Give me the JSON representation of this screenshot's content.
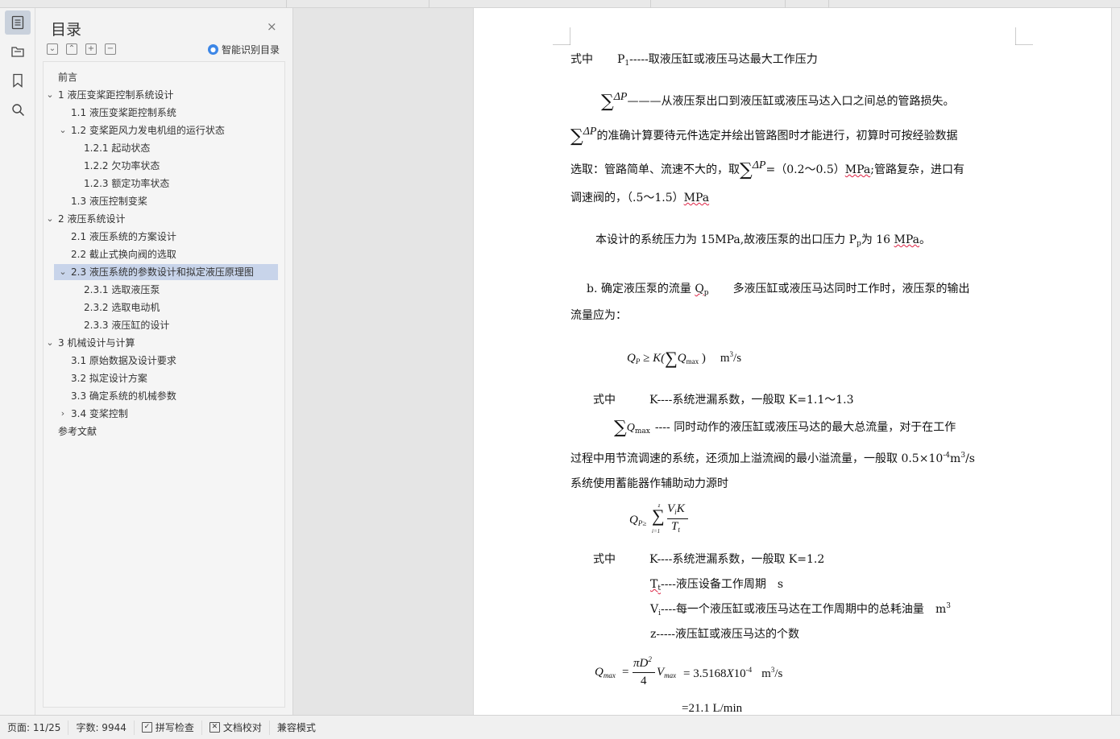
{
  "sidebar_rail": {
    "icons": [
      "outline-icon",
      "folder-tree-icon",
      "bookmark-icon",
      "search-icon"
    ]
  },
  "toc": {
    "title": "目录",
    "close": "×",
    "tools": [
      "⌄",
      "⌃",
      "+",
      "−"
    ],
    "smart_label": "智能识别目录",
    "items": [
      {
        "label": "前言",
        "level": 0,
        "chevron": ""
      },
      {
        "label": "1 液压变桨距控制系统设计",
        "level": 0,
        "chevron": "⌄"
      },
      {
        "label": "1.1 液压变桨距控制系统",
        "level": 1,
        "chevron": ""
      },
      {
        "label": "1.2  变桨距风力发电机组的运行状态",
        "level": 1,
        "chevron": "⌄"
      },
      {
        "label": "1.2.1 起动状态",
        "level": 2,
        "chevron": ""
      },
      {
        "label": "1.2.2 欠功率状态",
        "level": 2,
        "chevron": ""
      },
      {
        "label": "1.2.3 额定功率状态",
        "level": 2,
        "chevron": ""
      },
      {
        "label": "1.3  液压控制变桨",
        "level": 1,
        "chevron": ""
      },
      {
        "label": "2  液压系统设计",
        "level": 0,
        "chevron": "⌄"
      },
      {
        "label": "2.1  液压系统的方案设计",
        "level": 1,
        "chevron": ""
      },
      {
        "label": "2.2  截止式换向阀的选取",
        "level": 1,
        "chevron": ""
      },
      {
        "label": "2.3    液压系统的参数设计和拟定液压原理图",
        "level": 1,
        "chevron": "⌄",
        "selected": true
      },
      {
        "label": "2.3.1    选取液压泵",
        "level": 2,
        "chevron": ""
      },
      {
        "label": "2.3.2    选取电动机",
        "level": 2,
        "chevron": ""
      },
      {
        "label": "2.3.3 液压缸的设计",
        "level": 2,
        "chevron": ""
      },
      {
        "label": "3  机械设计与计算",
        "level": 0,
        "chevron": "⌄"
      },
      {
        "label": "3.1    原始数据及设计要求",
        "level": 1,
        "chevron": ""
      },
      {
        "label": "3.2    拟定设计方案",
        "level": 1,
        "chevron": ""
      },
      {
        "label": "3.3    确定系统的机械参数",
        "level": 1,
        "chevron": ""
      },
      {
        "label": "3.4 变桨控制",
        "level": 1,
        "chevron": "›"
      },
      {
        "label": "参考文献",
        "level": 0,
        "chevron": ""
      }
    ]
  },
  "document": {
    "l1_a": "式中",
    "l1_b": "P",
    "l1_b_sub": "1",
    "l1_c": "-----取液压缸或液压马达最大工作压力",
    "l2_sym": "ΔP",
    "l2_text": "———从液压泵出口到液压缸或液压马达入口之间总的管路损失。",
    "l3_sym": "ΔP",
    "l3_text": "的准确计算要待元件选定并绘出管路图时才能进行，初算时可按经验数据",
    "l4_a": "选取：管路简单、流速不大的，取",
    "l4_sym": "ΔP",
    "l4_b": "=（0.2～0.5）",
    "l4_c": "MPa",
    "l4_d": ";管路复杂，进口有",
    "l5_a": "调速阀的，（.5～1.5）",
    "l5_b": "MPa",
    "l6_a": "本设计的系统压力为 15MPa,故液压泵的出口压力 P",
    "l6_sub": "p",
    "l6_b": "为 16 ",
    "l6_c": "MPa",
    "l6_d": "。",
    "l7_a": "b. 确定液压泵的流量 ",
    "l7_b": "Q",
    "l7_sub": "p",
    "l7_c": "多液压缸或液压马达同时工作时，液压泵的输出",
    "l8": "流量应为：",
    "f1_a": "Q",
    "f1_sub": "P",
    "f1_b": " ≥ K(",
    "f1_c": "Q",
    "f1_csub": "max",
    "f1_d": " )",
    "f1_unit": "m",
    "f1_unit_sup": "3",
    "f1_unit_b": "/s",
    "l9_a": "式中",
    "l9_b": "K----系统泄漏系数，一般取 K=1.1～1.3",
    "l10_sym": "Q",
    "l10_sub": "max",
    "l10_text": "----  同时动作的液压缸或液压马达的最大总流量，对于在工作",
    "l11_a": "过程中用节流调速的系统，还须加上溢流阀的最小溢流量，一般取 0.5×10",
    "l11_sup": "-4",
    "l11_b": "m",
    "l11_sup2": "3",
    "l11_c": "/s",
    "l12": "系统使用蓄能器作辅助动力源时",
    "f2_lhs": "Q",
    "f2_lhs_sub": "P≥",
    "f2_top": "z",
    "f2_bot": "i=1",
    "f2_num": "V",
    "f2_num_sub": "i",
    "f2_num_b": "K",
    "f2_den": "T",
    "f2_den_sub": "t",
    "l13_a": "式中",
    "l13_b": "K----系统泄漏系数，一般取 K=1.2",
    "l14_a": "T",
    "l14_sub": "t",
    "l14_b": "----液压设备工作周期",
    "l14_c": "s",
    "l15_a": "V",
    "l15_sub": "i",
    "l15_b": "----每一个液压缸或液压马达在工作周期中的总耗油量",
    "l15_c": "m",
    "l15_sup": "3",
    "l16": "z-----液压缸或液压马达的个数",
    "f3_lhs": "Q",
    "f3_lhs_sub": "max",
    "f3_eq": "=",
    "f3_num": "πD",
    "f3_num_sup": "2",
    "f3_den": "4",
    "f3_v": "V",
    "f3_v_sub": "max",
    "f3_rhs": "= 3.5168",
    "f3_x": "X",
    "f3_pow": "10",
    "f3_pow_sup": "-4",
    "f3_unit": "m",
    "f3_unit_sup": "3",
    "f3_unit_b": "/s",
    "f4": "=21.1    L/min"
  },
  "status": {
    "page": "页面: 11/25",
    "words": "字数: 9944",
    "spell": "拼写检查",
    "proof": "文档校对",
    "compat": "兼容模式"
  }
}
